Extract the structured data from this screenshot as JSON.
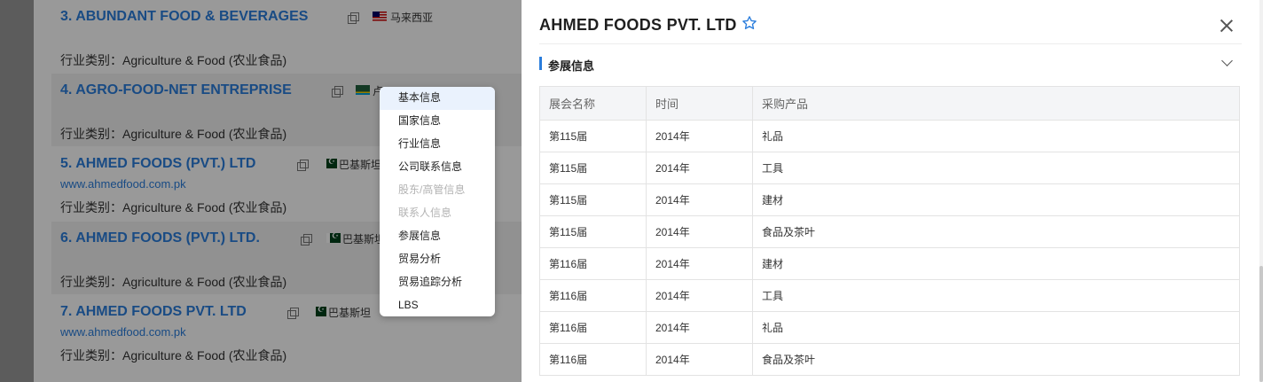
{
  "results": [
    {
      "title": "3. ABUNDANT FOOD & BEVERAGES",
      "country": "马来西亚",
      "flag": "malaysia-flag-icon",
      "website": "",
      "industry": "行业类别：Agriculture & Food (农业食品)"
    },
    {
      "title": "4. AGRO-FOOD-NET ENTREPRISE",
      "country": "卢",
      "flag": "rwanda-flag-icon",
      "website": "",
      "industry": "行业类别：Agriculture & Food (农业食品)"
    },
    {
      "title": "5. AHMED FOODS (PVT.) LTD",
      "country": "巴基斯坦",
      "flag": "pakistan-flag-icon",
      "website": "www.ahmedfood.com.pk",
      "industry": "行业类别：Agriculture & Food (农业食品)"
    },
    {
      "title": "6. AHMED FOODS (PVT.) LTD.",
      "country": "巴基斯坦",
      "flag": "pakistan-flag-icon",
      "website": "",
      "industry": "行业类别：Agriculture & Food (农业食品)"
    },
    {
      "title": "7. AHMED FOODS PVT. LTD",
      "country": "巴基斯坦",
      "flag": "pakistan-flag-icon",
      "website": "www.ahmedfood.com.pk",
      "industry": "行业类别：Agriculture & Food (农业食品)"
    }
  ],
  "menu": {
    "items": [
      {
        "label": "基本信息",
        "state": "active"
      },
      {
        "label": "国家信息",
        "state": "normal"
      },
      {
        "label": "行业信息",
        "state": "normal"
      },
      {
        "label": "公司联系信息",
        "state": "normal"
      },
      {
        "label": "股东/高管信息",
        "state": "disabled"
      },
      {
        "label": "联系人信息",
        "state": "disabled"
      },
      {
        "label": "参展信息",
        "state": "normal"
      },
      {
        "label": "贸易分析",
        "state": "normal"
      },
      {
        "label": "贸易追踪分析",
        "state": "normal"
      },
      {
        "label": "LBS",
        "state": "normal"
      }
    ]
  },
  "drawer": {
    "title": "AHMED FOODS PVT. LTD",
    "section_title": "参展信息",
    "table": {
      "headers": [
        "展会名称",
        "时间",
        "采购产品"
      ],
      "rows": [
        [
          "第115届",
          "2014年",
          "礼品"
        ],
        [
          "第115届",
          "2014年",
          "工具"
        ],
        [
          "第115届",
          "2014年",
          "建材"
        ],
        [
          "第115届",
          "2014年",
          "食品及茶叶"
        ],
        [
          "第116届",
          "2014年",
          "建材"
        ],
        [
          "第116届",
          "2014年",
          "工具"
        ],
        [
          "第116届",
          "2014年",
          "礼品"
        ],
        [
          "第116届",
          "2014年",
          "食品及茶叶"
        ]
      ]
    }
  },
  "colors": {
    "accent": "#2a7ddc",
    "overlay": "rgba(0,0,0,0.4)",
    "table_header_bg": "#f4f5f7"
  }
}
